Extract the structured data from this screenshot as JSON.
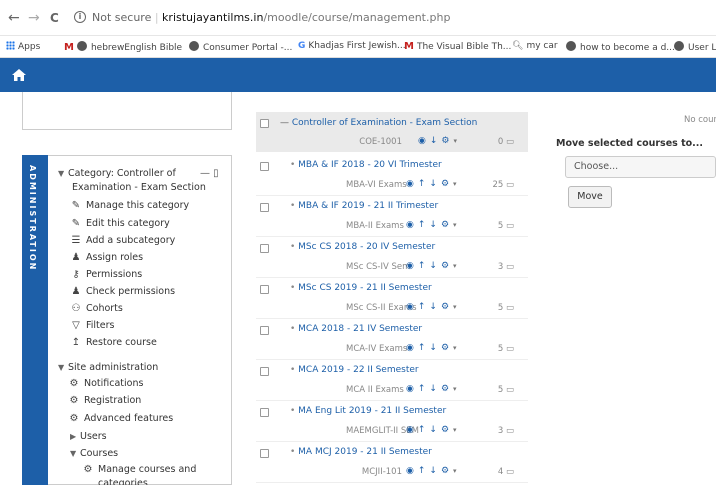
{
  "browser": {
    "back": "←",
    "forward": "→",
    "reload": "C",
    "security": "Not secure",
    "url_host": "kristujayantilms.in",
    "url_path": "/moodle/course/management.php",
    "bookmarks": [
      {
        "label": "Apps",
        "icon": "apps-grid-icon"
      },
      {
        "label": "hebrewEnglish Bible",
        "icon": "globe-icon"
      },
      {
        "label": "Consumer Portal -...",
        "icon": "globe-icon"
      },
      {
        "label": "Khadjas First Jewish...",
        "icon": "google-icon"
      },
      {
        "label": "The Visual Bible Th...",
        "icon": "gmail-icon"
      },
      {
        "label": "my car",
        "icon": "search-icon"
      },
      {
        "label": "how to become a d...",
        "icon": "globe-icon"
      },
      {
        "label": "User Lo",
        "icon": "globe-icon"
      }
    ]
  },
  "navbar": {
    "color": "#1d5fa8",
    "home_icon": "home-icon"
  },
  "admin": {
    "tab_label": "ADMINISTRATION",
    "category": "Category: Controller of Examination - Exam Section",
    "category_line1": "Category: Controller of",
    "category_line2": "Examination - Exam Section",
    "items": [
      {
        "label": "Manage this category",
        "icon": "pencil-icon"
      },
      {
        "label": "Edit this category",
        "icon": "pencil-icon"
      },
      {
        "label": "Add a subcategory",
        "icon": "list-icon"
      },
      {
        "label": "Assign roles",
        "icon": "user-icon"
      },
      {
        "label": "Permissions",
        "icon": "key-icon"
      },
      {
        "label": "Check permissions",
        "icon": "user-check-icon"
      },
      {
        "label": "Cohorts",
        "icon": "users-icon"
      },
      {
        "label": "Filters",
        "icon": "filter-icon"
      },
      {
        "label": "Restore course",
        "icon": "upload-icon"
      }
    ],
    "site_admin": "Site administration",
    "site_items": [
      {
        "label": "Notifications",
        "icon": "gear-icon"
      },
      {
        "label": "Registration",
        "icon": "gear-icon"
      },
      {
        "label": "Advanced features",
        "icon": "gear-icon"
      }
    ],
    "users": "Users",
    "courses": "Courses",
    "manage_courses_line1": "Manage courses and",
    "manage_courses_line2": "categories"
  },
  "list": {
    "header": {
      "title": "Controller of Examination - Exam Section",
      "idnumber": "COE-1001",
      "count": "0"
    },
    "courses": [
      {
        "name": "MBA & IF 2018 - 20 VI Trimester",
        "short": "MBA-VI Exams",
        "count": "25"
      },
      {
        "name": "MBA & IF 2019 - 21 II Trimester",
        "short": "MBA-II Exams",
        "count": "5"
      },
      {
        "name": "MSc CS 2018 - 20 IV Semester",
        "short": "MSc CS-IV Sem",
        "count": "3"
      },
      {
        "name": "MSc CS 2019 - 21 II Semester",
        "short": "MSc CS-II Exams",
        "count": "5"
      },
      {
        "name": "MCA 2018 - 21 IV Semester",
        "short": "MCA-IV Exams",
        "count": "5"
      },
      {
        "name": "MCA 2019 - 22 II Semester",
        "short": "MCA II Exams",
        "count": "5"
      },
      {
        "name": "MA Eng Lit 2019 - 21 II Semester",
        "short": "MAEMGLIT-II SEM",
        "count": "3"
      },
      {
        "name": "MA MCJ 2019 - 21 II Semester",
        "short": "MCJII-101",
        "count": "4"
      }
    ]
  },
  "right": {
    "no_courses": "No cour",
    "move_label": "Move selected courses to...",
    "select_value": "Choose...",
    "move_button": "Move"
  }
}
